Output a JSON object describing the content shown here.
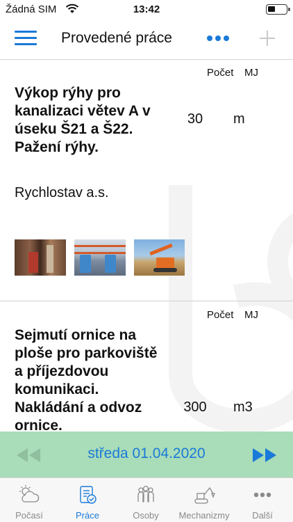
{
  "status_bar": {
    "carrier": "Žádná SIM",
    "time": "13:42",
    "wifi_icon": "wifi-icon",
    "battery_icon": "battery-icon"
  },
  "nav": {
    "title": "Provedené práce",
    "menu_icon": "hamburger-menu-icon",
    "more_icon": "more-dots-icon",
    "add_icon": "plus-icon",
    "add_enabled": false
  },
  "columns": {
    "count": "Počet",
    "unit": "MJ"
  },
  "entries": [
    {
      "title_lines": [
        "Výkop rýhy pro",
        "kanalizaci větev A v",
        "úseku Š21 a Š22.",
        "Pažení rýhy."
      ],
      "quantity": "30",
      "unit": "m",
      "company": "Rychlostav a.s.",
      "photos": [
        "trench-photo",
        "pipe-laying-photo",
        "excavator-photo"
      ]
    },
    {
      "title_lines": [
        "Sejmutí ornice na",
        "ploše pro parkoviště",
        "a příjezdovou",
        "komunikaci.",
        "Nakládání a odvoz",
        "ornice."
      ],
      "quantity": "300",
      "unit": "m3"
    }
  ],
  "date_bar": {
    "date": "středa 01.04.2020",
    "prev_icon": "double-chevron-left-icon",
    "next_icon": "double-chevron-right-icon",
    "prev_enabled": false,
    "next_enabled": true
  },
  "tabs": [
    {
      "label": "Počasí",
      "icon": "weather-icon",
      "active": false
    },
    {
      "label": "Práce",
      "icon": "work-report-icon",
      "active": true
    },
    {
      "label": "Osoby",
      "icon": "people-icon",
      "active": false
    },
    {
      "label": "Mechanizmy",
      "icon": "excavator-icon",
      "active": false
    },
    {
      "label": "Další",
      "icon": "more-dots-icon",
      "active": false
    }
  ],
  "colors": {
    "accent": "#1a7ad9",
    "date_bar_bg": "#a9dcb8",
    "tab_inactive": "#8a8a8a"
  }
}
